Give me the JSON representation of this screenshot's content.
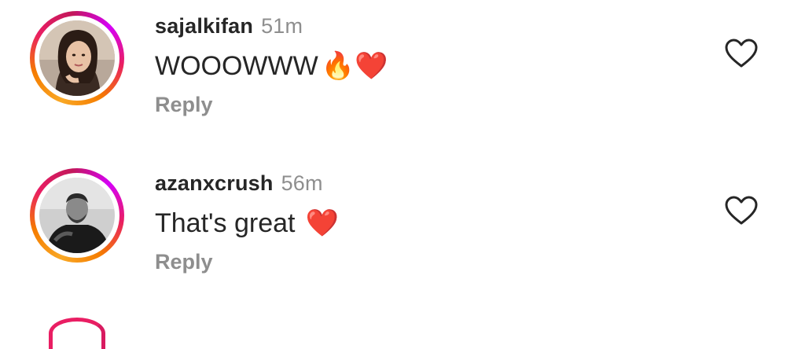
{
  "comments": [
    {
      "username": "sajalkifan",
      "time": "51m",
      "text": "WOOOWWW",
      "emojis": "🔥❤️",
      "reply_label": "Reply"
    },
    {
      "username": "azanxcrush",
      "time": "56m",
      "text": "That's great ",
      "emojis": "❤️",
      "reply_label": "Reply"
    }
  ],
  "icons": {
    "like": "heart-outline-icon"
  },
  "colors": {
    "username": "#262626",
    "muted": "#8e8e8e",
    "ring_start": "#f9a825",
    "ring_mid": "#e91e63",
    "ring_end": "#d500f9"
  }
}
